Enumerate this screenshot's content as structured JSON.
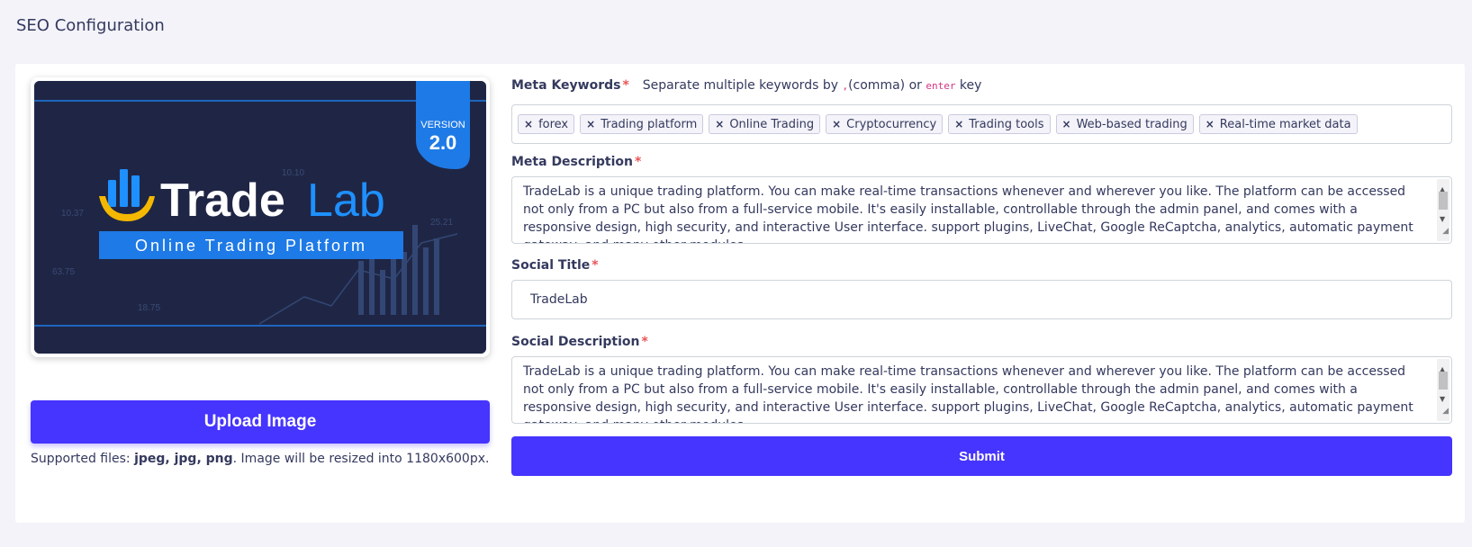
{
  "page": {
    "title": "SEO Configuration"
  },
  "image": {
    "brand_left": "Trade",
    "brand_right": "Lab",
    "tagline": "Online Trading Platform",
    "version_label": "VERSION",
    "version_number": "2.0",
    "chart_numbers": [
      "10.37",
      "63.75",
      "18.75",
      "25.21",
      "10.10"
    ]
  },
  "upload": {
    "button_label": "Upload Image",
    "supported_prefix": "Supported files: ",
    "supported_types": "jpeg, jpg, png",
    "supported_suffix": ". Image will be resized into 1180x600px."
  },
  "meta_keywords": {
    "label": "Meta Keywords",
    "hint_before": "Separate multiple keywords by ",
    "hint_comma": ",",
    "hint_middle": "(comma) or ",
    "hint_enter": "enter",
    "hint_after": " key",
    "tags": [
      "forex",
      "Trading platform",
      "Online Trading",
      "Cryptocurrency",
      "Trading tools",
      "Web-based trading",
      "Real-time market data"
    ],
    "remove_symbol": "×"
  },
  "meta_description": {
    "label": "Meta Description",
    "value": "TradeLab is a unique trading platform. You can make real-time transactions whenever and wherever you like. The platform can be accessed not only from a PC but also from a full-service mobile. It's easily installable, controllable through the admin panel, and comes with a responsive design, high security, and interactive User interface. support plugins, LiveChat, Google ReCaptcha, analytics, automatic payment gateway, and many other modules."
  },
  "social_title": {
    "label": "Social Title",
    "value": "TradeLab"
  },
  "social_description": {
    "label": "Social Description",
    "value": "TradeLab is a unique trading platform. You can make real-time transactions whenever and wherever you like. The platform can be accessed not only from a PC but also from a full-service mobile. It's easily installable, controllable through the admin panel, and comes with a responsive design, high security, and interactive User interface. support plugins, LiveChat, Google ReCaptcha, analytics, automatic payment gateway, and many other modules."
  },
  "submit": {
    "label": "Submit"
  },
  "required_mark": "*",
  "colors": {
    "primary": "#4634ff",
    "required": "#ea5455",
    "brand_blue": "#1e90ff",
    "image_bg": "#1f2645"
  },
  "icons": [
    "chart-bars-icon",
    "close-icon",
    "scroll-up-icon",
    "scroll-down-icon",
    "resize-handle-icon"
  ]
}
